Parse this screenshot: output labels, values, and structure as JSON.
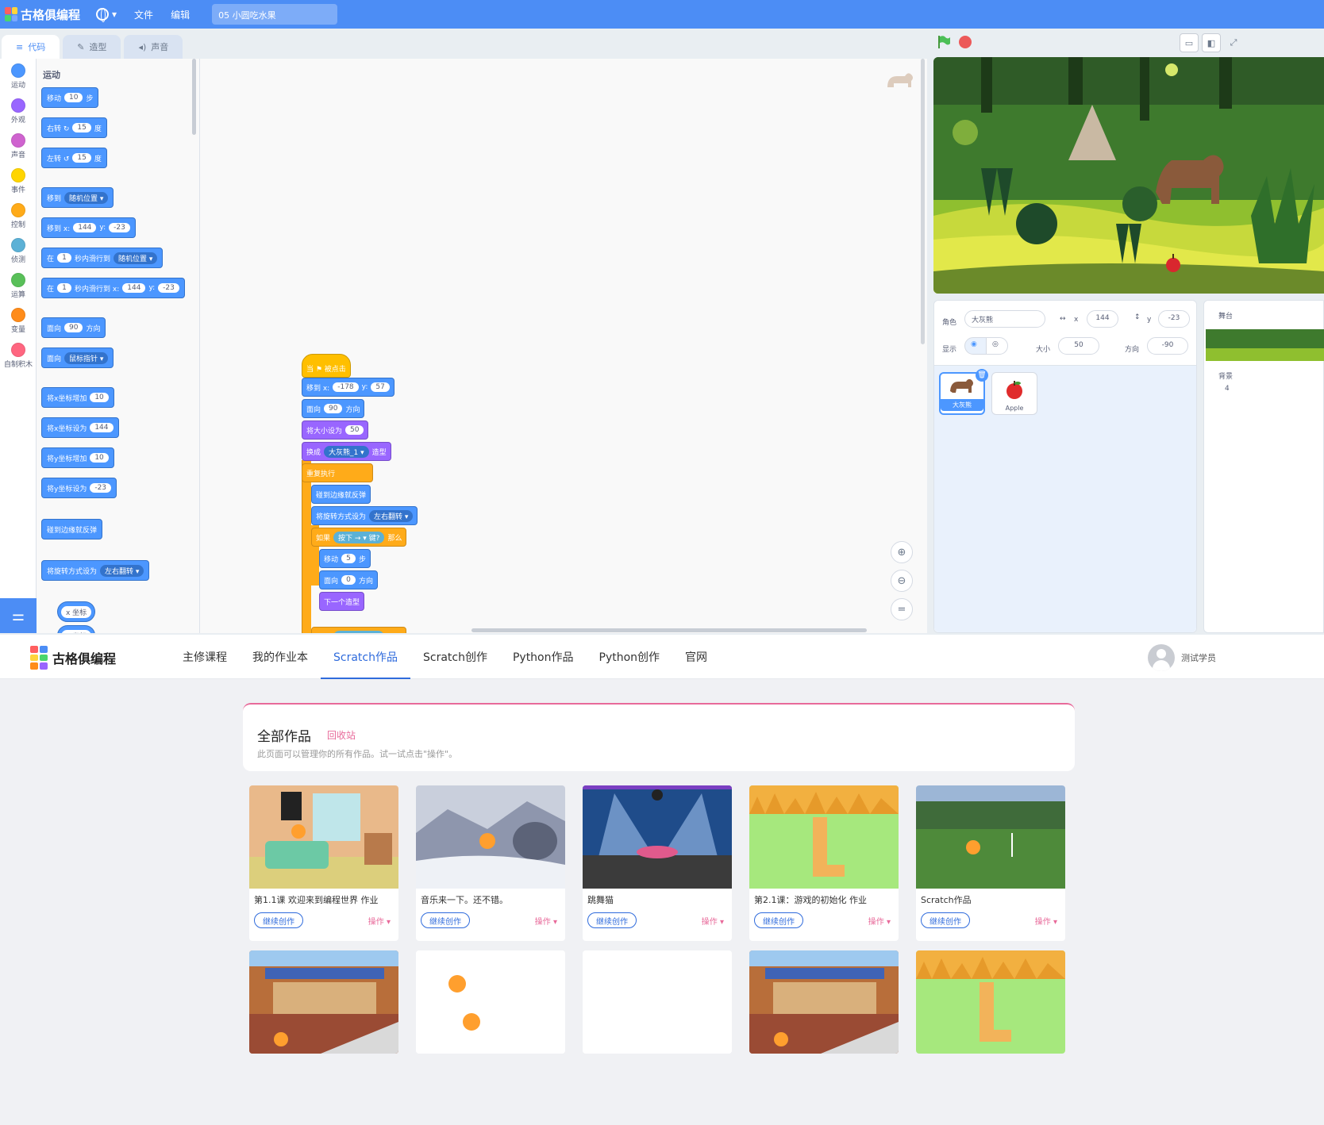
{
  "editor": {
    "brand": "古格俱编程",
    "menu": {
      "file": "文件",
      "edit": "编辑"
    },
    "project_title": "05 小圆吃水果",
    "tabs": [
      "代码",
      "造型",
      "声音"
    ],
    "categories": [
      {
        "label": "运动",
        "color": "#4c97ff"
      },
      {
        "label": "外观",
        "color": "#9966ff"
      },
      {
        "label": "声音",
        "color": "#cf63cf"
      },
      {
        "label": "事件",
        "color": "#ffd500"
      },
      {
        "label": "控制",
        "color": "#ffab19"
      },
      {
        "label": "侦测",
        "color": "#5cb1d6"
      },
      {
        "label": "运算",
        "color": "#59c059"
      },
      {
        "label": "变量",
        "color": "#ff8c1a"
      },
      {
        "label": "自制积木",
        "color": "#ff6680"
      }
    ],
    "palette": {
      "title": "运动",
      "blocks": [
        {
          "parts": [
            {
              "t": "移动"
            },
            {
              "p": "10"
            },
            {
              "t": "步"
            }
          ]
        },
        {
          "parts": [
            {
              "t": "右转 ↻"
            },
            {
              "p": "15"
            },
            {
              "t": "度"
            }
          ]
        },
        {
          "parts": [
            {
              "t": "左转 ↺"
            },
            {
              "p": "15"
            },
            {
              "t": "度"
            }
          ]
        },
        {
          "parts": [
            {
              "t": "移到"
            },
            {
              "d": "随机位置 ▾"
            }
          ]
        },
        {
          "parts": [
            {
              "t": "移到 x:"
            },
            {
              "p": "144"
            },
            {
              "t": "y:"
            },
            {
              "p": "-23"
            }
          ]
        },
        {
          "parts": [
            {
              "t": "在"
            },
            {
              "p": "1"
            },
            {
              "t": "秒内滑行到"
            },
            {
              "d": "随机位置 ▾"
            }
          ]
        },
        {
          "parts": [
            {
              "t": "在"
            },
            {
              "p": "1"
            },
            {
              "t": "秒内滑行到 x:"
            },
            {
              "p": "144"
            },
            {
              "t": "y:"
            },
            {
              "p": "-23"
            }
          ]
        },
        {
          "parts": [
            {
              "t": "面向"
            },
            {
              "p": "90"
            },
            {
              "t": "方向"
            }
          ]
        },
        {
          "parts": [
            {
              "t": "面向"
            },
            {
              "d": "鼠标指针 ▾"
            }
          ]
        },
        {
          "parts": [
            {
              "t": "将x坐标增加"
            },
            {
              "p": "10"
            }
          ]
        },
        {
          "parts": [
            {
              "t": "将x坐标设为"
            },
            {
              "p": "144"
            }
          ]
        },
        {
          "parts": [
            {
              "t": "将y坐标增加"
            },
            {
              "p": "10"
            }
          ]
        },
        {
          "parts": [
            {
              "t": "将y坐标设为"
            },
            {
              "p": "-23"
            }
          ]
        },
        {
          "parts": [
            {
              "t": "碰到边缘就反弹"
            }
          ]
        },
        {
          "parts": [
            {
              "t": "将旋转方式设为"
            },
            {
              "d": "左右翻转 ▾"
            }
          ]
        },
        {
          "parts": [
            {
              "p": "x 坐标"
            }
          ]
        },
        {
          "parts": [
            {
              "p": "y 坐标"
            }
          ]
        }
      ]
    },
    "script": [
      {
        "cat": "events",
        "parts": [
          {
            "t": "当 ⚑ 被点击"
          }
        ]
      },
      {
        "cat": "motion",
        "parts": [
          {
            "t": "移到 x:"
          },
          {
            "p": "-178"
          },
          {
            "t": "y:"
          },
          {
            "p": "57"
          }
        ]
      },
      {
        "cat": "motion",
        "parts": [
          {
            "t": "面向"
          },
          {
            "p": "90"
          },
          {
            "t": "方向"
          }
        ]
      },
      {
        "cat": "looks",
        "parts": [
          {
            "t": "将大小设为"
          },
          {
            "p": "50"
          }
        ]
      },
      {
        "cat": "looks",
        "parts": [
          {
            "t": "换成"
          },
          {
            "d": "大灰熊_1 ▾"
          },
          {
            "t": "造型"
          }
        ]
      },
      {
        "cat": "control",
        "parts": [
          {
            "t": "重复执行"
          }
        ]
      },
      {
        "cat": "motion",
        "parts": [
          {
            "t": "碰到边缘就反弹"
          }
        ]
      },
      {
        "cat": "motion",
        "parts": [
          {
            "t": "将旋转方式设为"
          },
          {
            "d": "左右翻转 ▾"
          }
        ]
      },
      {
        "cat": "control",
        "parts": [
          {
            "t": "如果"
          },
          {
            "s": "按下 → ▾ 键?"
          },
          {
            "t": "那么"
          }
        ]
      },
      {
        "cat": "motion",
        "parts": [
          {
            "t": "移动"
          },
          {
            "p": "5"
          },
          {
            "t": "步"
          }
        ]
      },
      {
        "cat": "motion",
        "parts": [
          {
            "t": "面向"
          },
          {
            "p": "0"
          },
          {
            "t": "方向"
          }
        ]
      },
      {
        "cat": "looks",
        "parts": [
          {
            "t": "下一个造型"
          }
        ]
      },
      {
        "cat": "control",
        "parts": [
          {
            "t": "如果"
          },
          {
            "s": "按下 ↓ ▾ 键?"
          },
          {
            "t": "那么"
          }
        ]
      }
    ],
    "zoom_icons": [
      "⊕",
      "⊖",
      "="
    ],
    "sprite_info": {
      "sprite_label": "角色",
      "sprite_name": "大灰熊",
      "x_label": "x",
      "x": "144",
      "y_label": "y",
      "y": "-23",
      "show_label": "显示",
      "size_label": "大小",
      "size": "50",
      "direction_label": "方向",
      "direction": "-90"
    },
    "sprites": [
      {
        "name": "大灰熊",
        "icon": "bear-icon",
        "selected": true
      },
      {
        "name": "Apple",
        "icon": "apple-icon",
        "selected": false
      }
    ],
    "stage_pane": {
      "title": "舞台",
      "backdrops_label": "背景",
      "backdrops_count": "4"
    }
  },
  "nav": {
    "brand": "古格俱编程",
    "links": [
      "主修课程",
      "我的作业本",
      "Scratch作品",
      "Scratch创作",
      "Python作品",
      "Python创作",
      "官网"
    ],
    "active_index": 2,
    "user_name": "测试学员"
  },
  "works": {
    "title": "全部作品",
    "recycle": "回收站",
    "subtitle": "此页面可以管理你的所有作品。试一试点击\"操作\"。",
    "continue_label": "继续创作",
    "op_label": "操作 ▾",
    "cards": [
      {
        "title": "第1.1课 欢迎来到编程世界 作业",
        "thumb": "bedroom"
      },
      {
        "title": "音乐来一下。还不错。",
        "thumb": "winter"
      },
      {
        "title": "跳舞猫",
        "thumb": "concert"
      },
      {
        "title": "第2.1课：游戏的初始化 作业",
        "thumb": "grid-desert"
      },
      {
        "title": "Scratch作品",
        "thumb": "soccer-field"
      },
      {
        "title": "",
        "thumb": "street"
      },
      {
        "title": "",
        "thumb": "cats-white"
      },
      {
        "title": "",
        "thumb": "blank"
      },
      {
        "title": "",
        "thumb": "street"
      },
      {
        "title": "",
        "thumb": "grid-desert"
      }
    ]
  }
}
